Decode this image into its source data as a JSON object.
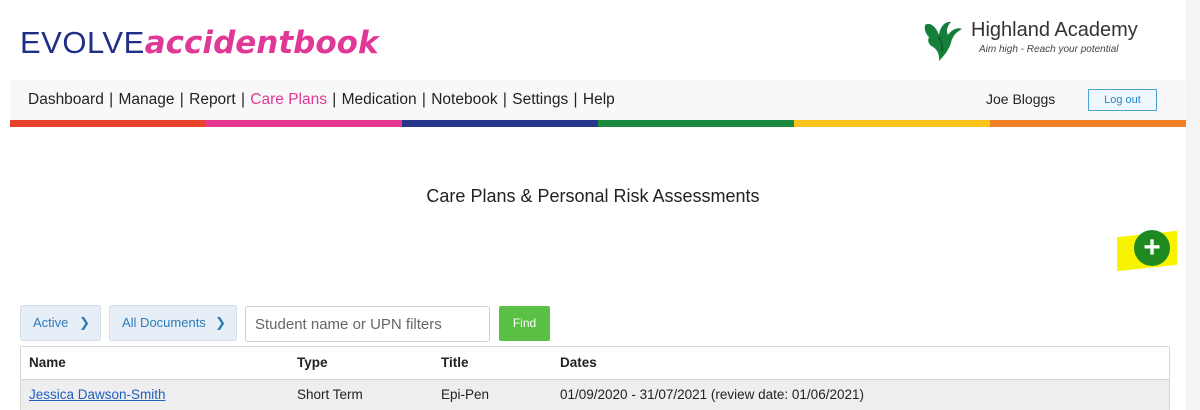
{
  "brand": {
    "part1": "EVOLVE",
    "part2": "accidentbook"
  },
  "school": {
    "name": "Highland Academy",
    "motto": "Aim high - Reach your potential"
  },
  "nav": {
    "items": [
      {
        "label": "Dashboard",
        "active": false
      },
      {
        "label": "Manage",
        "active": false
      },
      {
        "label": "Report",
        "active": false
      },
      {
        "label": "Care Plans",
        "active": true
      },
      {
        "label": "Medication",
        "active": false
      },
      {
        "label": "Notebook",
        "active": false
      },
      {
        "label": "Settings",
        "active": false
      },
      {
        "label": "Help",
        "active": false
      }
    ],
    "separator": "|",
    "user_name": "Joe Bloggs",
    "logout_label": "Log out"
  },
  "rainbow_colors": [
    "#e8412c",
    "#e53893",
    "#27378c",
    "#1b8a3e",
    "#fbc31b",
    "#f08124"
  ],
  "page": {
    "title": "Care Plans & Personal Risk Assessments",
    "add_icon": "plus-circle-icon",
    "accent_green": "#1f8a1f"
  },
  "filters": {
    "status": "Active",
    "documents": "All Documents",
    "search_placeholder": "Student name or UPN filters",
    "find_label": "Find"
  },
  "table": {
    "headers": [
      "Name",
      "Type",
      "Title",
      "Dates"
    ],
    "rows": [
      [
        "Jessica Dawson-Smith",
        "Short Term",
        "Epi-Pen",
        "01/09/2020 - 31/07/2021 (review date: 01/06/2021)"
      ]
    ]
  }
}
